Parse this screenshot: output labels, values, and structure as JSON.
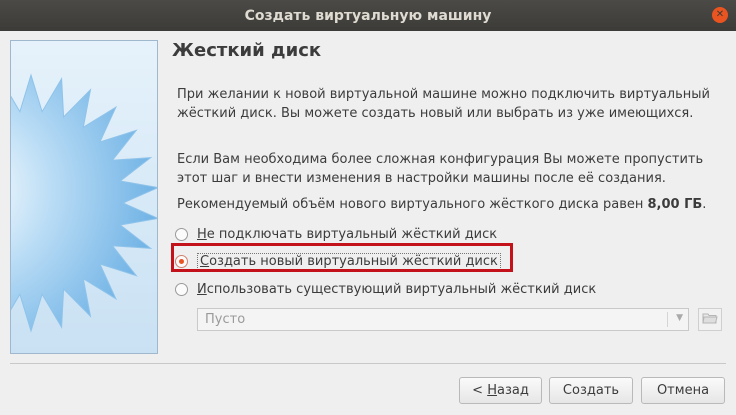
{
  "window": {
    "title": "Создать виртуальную машину"
  },
  "icons": {
    "close": "close-icon",
    "folder": "folder-open-icon",
    "watermark": "starburst-watermark"
  },
  "page": {
    "heading": "Жесткий диск",
    "intro": "При желании к новой виртуальной машине можно подключить виртуальный жёсткий диск. Вы можете создать новый или выбрать из уже имеющихся.",
    "advanced": "Если Вам необходима более сложная конфигурация Вы можете пропустить этот шаг и внести изменения в настройки машины после её создания.",
    "recommended_prefix": "Рекомендуемый объём нового виртуального жёсткого диска равен",
    "recommended_size": "8,00 ГБ",
    "recommended_suffix": "."
  },
  "options": [
    {
      "mnemonic": "Н",
      "rest": "е подключать виртуальный жёсткий диск",
      "selected": false
    },
    {
      "mnemonic": "С",
      "rest": "оздать новый виртуальный жёсткий диск",
      "selected": true
    },
    {
      "mnemonic": "И",
      "rest": "спользовать существующий виртуальный жёсткий диск",
      "selected": false
    }
  ],
  "disk_select": {
    "value": "Пусто",
    "enabled": false
  },
  "buttons": {
    "back_prefix": "< ",
    "back_mnemonic": "Н",
    "back_rest": "азад",
    "create": "Создать",
    "cancel": "Отмена"
  },
  "colors": {
    "accent": "#e95420",
    "highlight_box": "#c4121a",
    "titlebar": "#3c3b37"
  }
}
